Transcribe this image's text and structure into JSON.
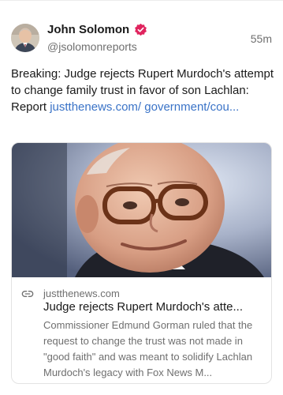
{
  "author": {
    "name": "John Solomon",
    "handle": "@jsolomonreports",
    "timestamp": "55m",
    "verified_icon": "verified-badge-icon",
    "verified_color": "#e0245e"
  },
  "post": {
    "text": "Breaking: Judge rejects Rupert Murdoch's attempt to change family trust in favor of son Lachlan: Report ",
    "link_text": "justthenews.com/ government/cou..."
  },
  "link_card": {
    "domain": "justthenews.com",
    "title": "Judge rejects Rupert Murdoch's atte...",
    "description": "Commissioner Edmund Gorman ruled that the request to change the trust was not made in \"good faith\" and was meant to solidify Lachlan Murdoch's legacy with Fox News M...",
    "icon": "link-icon",
    "link_color": "#3a73c7"
  }
}
